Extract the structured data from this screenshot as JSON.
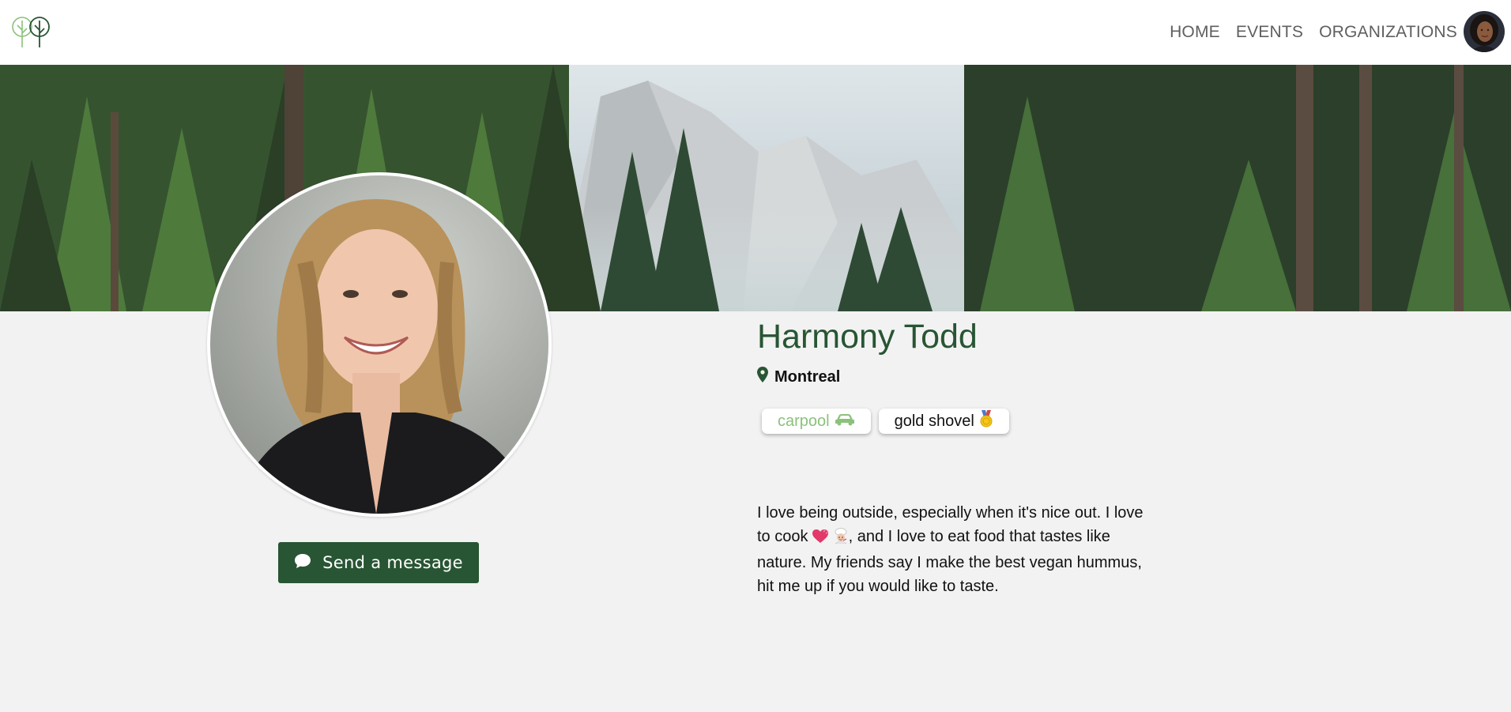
{
  "nav": {
    "logo_icon": "trees-logo",
    "links": [
      "HOME",
      "EVENTS",
      "ORGANIZATIONS"
    ],
    "avatar_icon": "user-avatar"
  },
  "banner": {
    "image": "forest-mountain-banner"
  },
  "profile": {
    "photo": "profile-photo",
    "name": "Harmony Todd",
    "location": "Montreal",
    "location_icon": "map-pin-icon",
    "badges": [
      {
        "label": "carpool",
        "icon": "car-icon"
      },
      {
        "label": "gold shovel",
        "icon": "medal-icon"
      }
    ],
    "bio_before": "I love being outside, especially when it's nice out. I love to cook ",
    "bio_after": ", and I love to eat food that tastes like nature. My friends say I make the best vegan hummus, hit me up if you would like to taste.",
    "bio_icons": [
      "heart-icon",
      "chef-icon"
    ],
    "send_message": "Send a message",
    "send_icon": "chat-bubble-icon"
  },
  "colors": {
    "brand_green": "#285533",
    "carpool_green": "#8ac27a",
    "background": "#f2f2f2",
    "nav_text": "#5f5f5f"
  }
}
